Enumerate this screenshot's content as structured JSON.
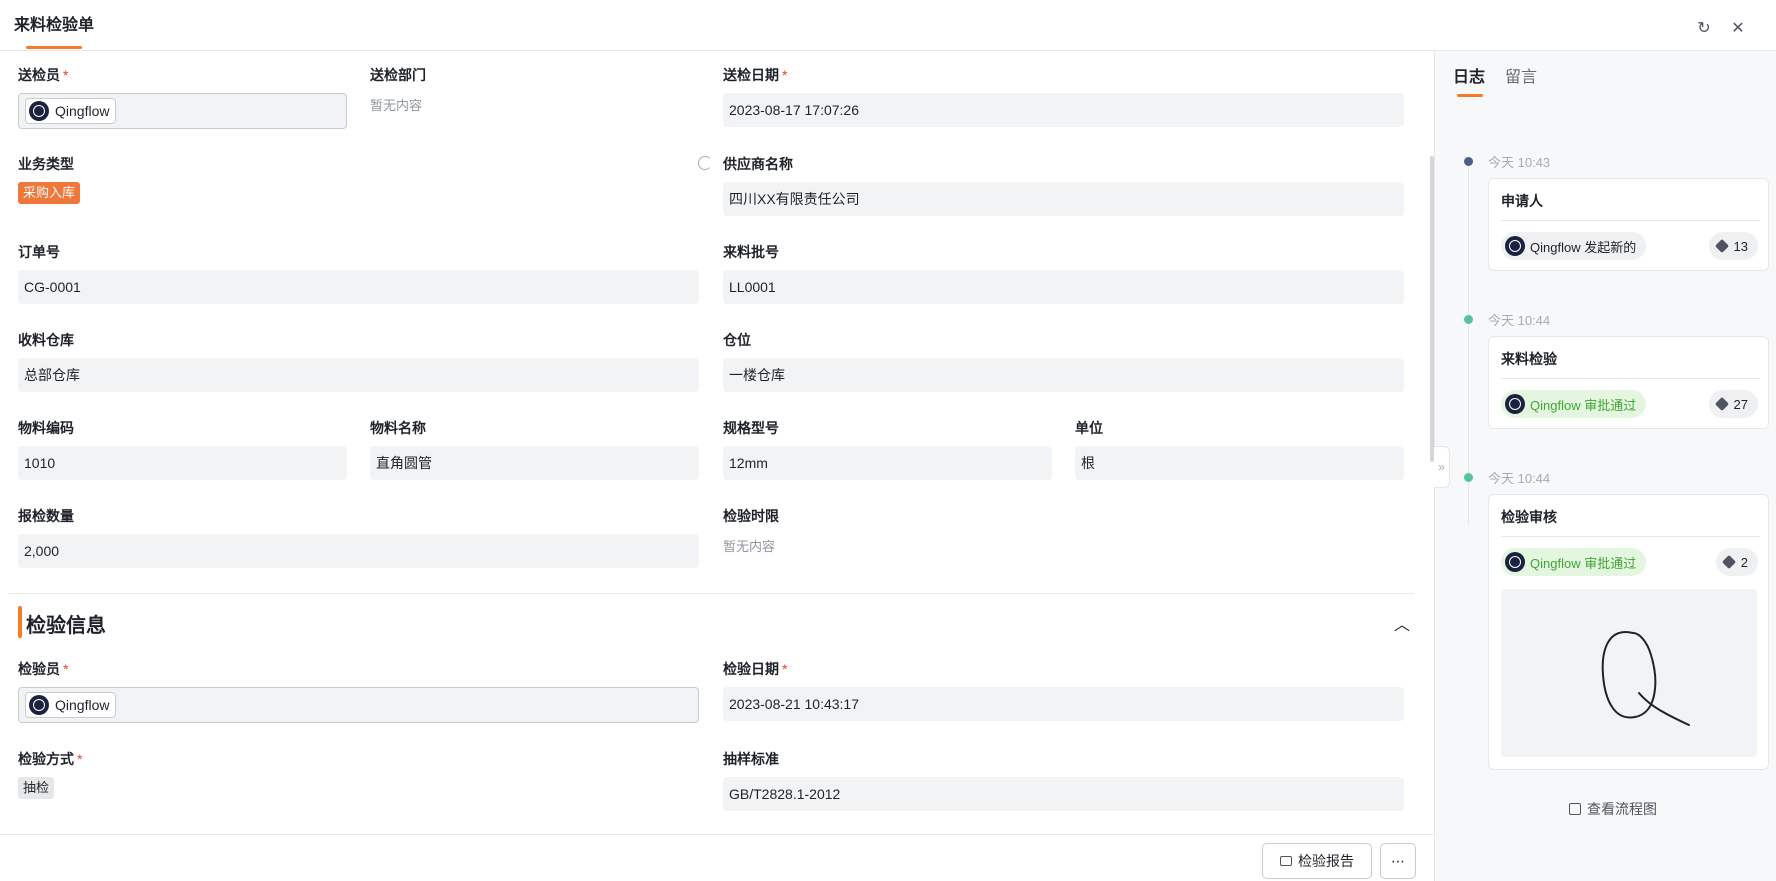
{
  "header": {
    "title": "来料检验单",
    "refresh_icon": "↻",
    "close_icon": "✕"
  },
  "form": {
    "submitter": {
      "label": "送检员",
      "value": "Qingflow"
    },
    "department": {
      "label": "送检部门",
      "value": "暂无内容"
    },
    "submit_date": {
      "label": "送检日期",
      "value": "2023-08-17 17:07:26"
    },
    "business_type": {
      "label": "业务类型",
      "value": "采购入库"
    },
    "supplier": {
      "label": "供应商名称",
      "value": "四川XX有限责任公司"
    },
    "order_no": {
      "label": "订单号",
      "value": "CG-0001"
    },
    "batch_no": {
      "label": "来料批号",
      "value": "LL0001"
    },
    "warehouse": {
      "label": "收料仓库",
      "value": "总部仓库"
    },
    "location": {
      "label": "仓位",
      "value": "一楼仓库"
    },
    "material_code": {
      "label": "物料编码",
      "value": "1010"
    },
    "material_name": {
      "label": "物料名称",
      "value": "直角圆管"
    },
    "spec": {
      "label": "规格型号",
      "value": "12mm"
    },
    "unit": {
      "label": "单位",
      "value": "根"
    },
    "quantity": {
      "label": "报检数量",
      "value": "2,000"
    },
    "time_limit": {
      "label": "检验时限",
      "value": "暂无内容"
    }
  },
  "inspection": {
    "section_title": "检验信息",
    "inspector": {
      "label": "检验员",
      "value": "Qingflow"
    },
    "inspect_date": {
      "label": "检验日期",
      "value": "2023-08-21 10:43:17"
    },
    "method": {
      "label": "检验方式",
      "value": "抽检"
    },
    "standard": {
      "label": "抽样标准",
      "value": "GB/T2828.1-2012"
    }
  },
  "footer": {
    "report_button": "检验报告",
    "more_button": "⋯"
  },
  "panel": {
    "tabs": [
      "日志",
      "留言"
    ],
    "active_tab": "日志",
    "entries": [
      {
        "time": "今天 10:43",
        "title": "申请人",
        "actor": "Qingflow 发起新的",
        "count": "13",
        "status_color": "#4a5f86"
      },
      {
        "time": "今天 10:44",
        "title": "来料检验",
        "actor": "Qingflow 审批通过",
        "count": "27",
        "status_color": "#55c49d"
      },
      {
        "time": "今天 10:44",
        "title": "检验审核",
        "actor": "Qingflow 审批通过",
        "count": "2",
        "status_color": "#55c49d"
      }
    ],
    "flow_link": "查看流程图"
  },
  "colors": {
    "accent": "#f57b25",
    "required": "#e8412f",
    "approved_text": "#3fa733",
    "approved_bg": "#e4f6e0"
  }
}
